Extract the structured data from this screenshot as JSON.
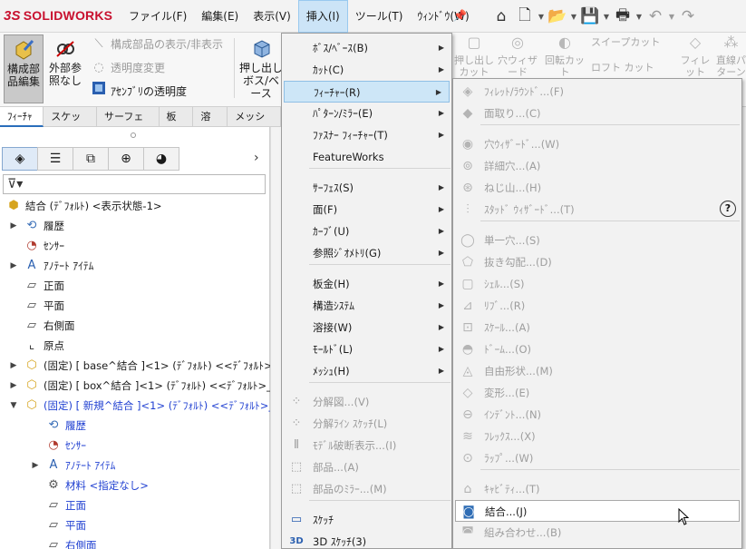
{
  "app": {
    "logo_ds": "3S",
    "logo_text": "SOLIDWORKS"
  },
  "menubar": [
    {
      "label": "ファイル(F)"
    },
    {
      "label": "編集(E)"
    },
    {
      "label": "表示(V)"
    },
    {
      "label": "挿入(I)"
    },
    {
      "label": "ツール(T)"
    },
    {
      "label": "ｳｨﾝﾄﾞｳ(W)"
    }
  ],
  "commandmanager": {
    "edit_component": "構成部品編集",
    "external_ref": "外部参照なし",
    "show_hide_components": "構成部品の表示/非表示",
    "change_transparency": "透明度変更",
    "assembly_transparency": "ｱｾﾝﾌﾞﾘの透明度",
    "extrude": "押し出しボス/ベース",
    "ghost": [
      "押し出しカット",
      "穴ウィザード",
      "回転カット",
      "スイープカット",
      "ロフト カット",
      "フィレット",
      "直線パターン"
    ]
  },
  "tabs": [
    "ﾌｨｰﾁｬｰ",
    "スケッチ",
    "サーフェス",
    "板金",
    "溶接",
    "メッシュ"
  ],
  "tree": [
    {
      "label": "結合 (ﾃﾞﾌｫﾙﾄ) <表示状態-1>",
      "icon": "assembly-icon",
      "blue": false
    },
    {
      "label": "履歴",
      "icon": "history-icon",
      "blue": false
    },
    {
      "label": "ｾﾝｻｰ",
      "icon": "sensor-icon",
      "blue": false
    },
    {
      "label": "ｱﾉﾃｰﾄ ｱｲﾃﾑ",
      "icon": "annotation-icon",
      "blue": false
    },
    {
      "label": "正面",
      "icon": "plane-icon",
      "blue": false
    },
    {
      "label": "平面",
      "icon": "plane-icon",
      "blue": false
    },
    {
      "label": "右側面",
      "icon": "plane-icon",
      "blue": false
    },
    {
      "label": "原点",
      "icon": "origin-icon",
      "blue": false
    },
    {
      "label": "(固定) [ base^結合 ]<1> (ﾃﾞﾌｫﾙﾄ) <<ﾃﾞﾌｫﾙﾄ>_表",
      "icon": "part-icon",
      "blue": false
    },
    {
      "label": "(固定) [ box^結合 ]<1> (ﾃﾞﾌｫﾙﾄ) <<ﾃﾞﾌｫﾙﾄ>_表",
      "icon": "part-icon",
      "blue": false
    },
    {
      "label": "(固定) [ 新規^結合 ]<1> (ﾃﾞﾌｫﾙﾄ) <<ﾃﾞﾌｫﾙﾄ>_表",
      "icon": "part-icon",
      "blue": true
    },
    {
      "label": "履歴",
      "icon": "history-icon",
      "blue": true
    },
    {
      "label": "ｾﾝｻｰ",
      "icon": "sensor-icon",
      "blue": true
    },
    {
      "label": "ｱﾉﾃｰﾄ ｱｲﾃﾑ",
      "icon": "annotation-icon",
      "blue": true
    },
    {
      "label": "材料 <指定なし>",
      "icon": "material-icon",
      "blue": true
    },
    {
      "label": "正面",
      "icon": "plane-icon",
      "blue": true
    },
    {
      "label": "平面",
      "icon": "plane-icon",
      "blue": true
    },
    {
      "label": "右側面",
      "icon": "plane-icon",
      "blue": true
    }
  ],
  "insert_menu": [
    {
      "label": "ﾎﾞｽ/ﾍﾞｰｽ(B)"
    },
    {
      "label": "ｶｯﾄ(C)"
    },
    {
      "label": "ﾌｨｰﾁｬｰ(R)"
    },
    {
      "label": "ﾊﾟﾀｰﾝ/ﾐﾗｰ(E)"
    },
    {
      "label": "ﾌｧｽﾅｰ ﾌｨｰﾁｬｰ(T)"
    },
    {
      "label": "FeatureWorks"
    },
    {
      "label": "ｻｰﾌｪｽ(S)"
    },
    {
      "label": "面(F)"
    },
    {
      "label": "ｶｰﾌﾞ(U)"
    },
    {
      "label": "参照ｼﾞｵﾒﾄﾘ(G)"
    },
    {
      "label": "板金(H)"
    },
    {
      "label": "構造ｼｽﾃﾑ"
    },
    {
      "label": "溶接(W)"
    },
    {
      "label": "ﾓｰﾙﾄﾞ(L)"
    },
    {
      "label": "ﾒｯｼｭ(H)"
    },
    {
      "label": "分解図...(V)"
    },
    {
      "label": "分解ﾗｲﾝ ｽｹｯﾁ(L)"
    },
    {
      "label": "ﾓﾃﾞﾙ破断表示...(I)"
    },
    {
      "label": "部品...(A)"
    },
    {
      "label": "部品のﾐﾗｰ...(M)"
    },
    {
      "label": "ｽｹｯﾁ"
    },
    {
      "label": "3D ｽｹｯﾁ(3)"
    }
  ],
  "feature_submenu": [
    {
      "label": "ﾌｨﾚｯﾄ/ﾗｳﾝﾄﾞ...(F)"
    },
    {
      "label": "面取り...(C)"
    },
    {
      "label": "穴ｳｨｻﾞｰﾄﾞ...(W)"
    },
    {
      "label": "詳細穴...(A)"
    },
    {
      "label": "ねじ山...(H)"
    },
    {
      "label": "ｽﾀｯﾄﾞ ｳｨｻﾞｰﾄﾞ...(T)"
    },
    {
      "label": "単一穴...(S)"
    },
    {
      "label": "抜き勾配...(D)"
    },
    {
      "label": "ｼｪﾙ...(S)"
    },
    {
      "label": "ﾘﾌﾞ...(R)"
    },
    {
      "label": "ｽｹｰﾙ...(A)"
    },
    {
      "label": "ﾄﾞｰﾑ...(O)"
    },
    {
      "label": "自由形状...(M)"
    },
    {
      "label": "変形...(E)"
    },
    {
      "label": "ｲﾝﾃﾞﾝﾄ...(N)"
    },
    {
      "label": "ﾌﾚｯｸｽ...(X)"
    },
    {
      "label": "ﾗｯﾌﾟ...(W)"
    },
    {
      "label": "ｷｬﾋﾞﾃｨ...(T)"
    },
    {
      "label": "結合...(J)"
    },
    {
      "label": "組み合わせ...(B)"
    }
  ]
}
